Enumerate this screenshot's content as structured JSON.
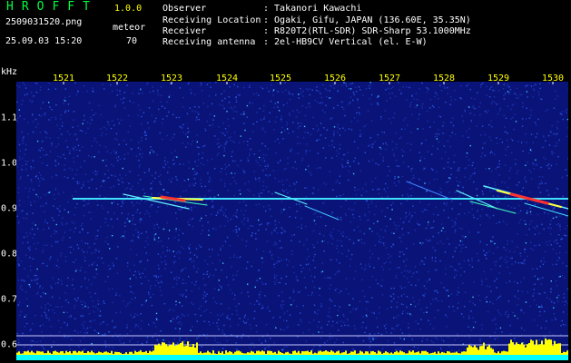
{
  "header": {
    "title": "HROFFT",
    "version": "1.0.0",
    "filename": "2509031520.png",
    "datetime": "25.09.03 15:20",
    "mode_label": "meteor",
    "count": "70"
  },
  "info": [
    {
      "label": "Observer",
      "value": ": Takanori Kawachi"
    },
    {
      "label": "Receiving Location",
      "value": ": Ogaki, Gifu, JAPAN (136.60E, 35.35N)"
    },
    {
      "label": "Receiver",
      "value": ": R820T2(RTL-SDR) SDR-Sharp 53.1000MHz"
    },
    {
      "label": "Receiving antenna",
      "value": ": 2el-HB9CV Vertical (el. E-W)"
    }
  ],
  "axis": {
    "y_unit": "kHz",
    "y_ticks": [
      "1.1",
      "1.0",
      "0.9",
      "0.8",
      "0.7",
      "0.6"
    ],
    "x_ticks": [
      "1521",
      "1522",
      "1523",
      "1524",
      "1525",
      "1526",
      "1527",
      "1528",
      "1529",
      "1530"
    ]
  },
  "colors": {
    "background": "#000000",
    "waterfall": "#0a1478",
    "noise": "#1e3cc8",
    "carrier": "#40e0ff",
    "strong": "#ff3030",
    "power_trace": "#ffff00",
    "baseline": "#00ffff",
    "title": "#00ff40",
    "tick_labels": "#ffff00"
  }
}
